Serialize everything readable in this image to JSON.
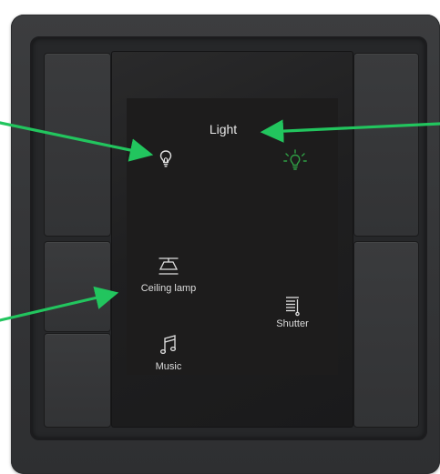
{
  "screen": {
    "title": "Light",
    "tiles": [
      {
        "name": "bulb",
        "label": "",
        "icon": "bulb-outline-icon"
      },
      {
        "name": "light-on",
        "label": "",
        "icon": "bulb-lit-icon"
      },
      {
        "name": "ceiling-lamp",
        "label": "Ceiling lamp",
        "icon": "ceiling-lamp-icon"
      },
      {
        "name": "shutter",
        "label": "Shutter",
        "icon": "shutter-icon"
      },
      {
        "name": "music",
        "label": "Music",
        "icon": "music-note-icon"
      }
    ]
  },
  "colors": {
    "accent_green": "#22c55e",
    "lit_bulb": "#2f9e44",
    "plate": "#37383a",
    "display_bg": "#1d1c1c"
  }
}
